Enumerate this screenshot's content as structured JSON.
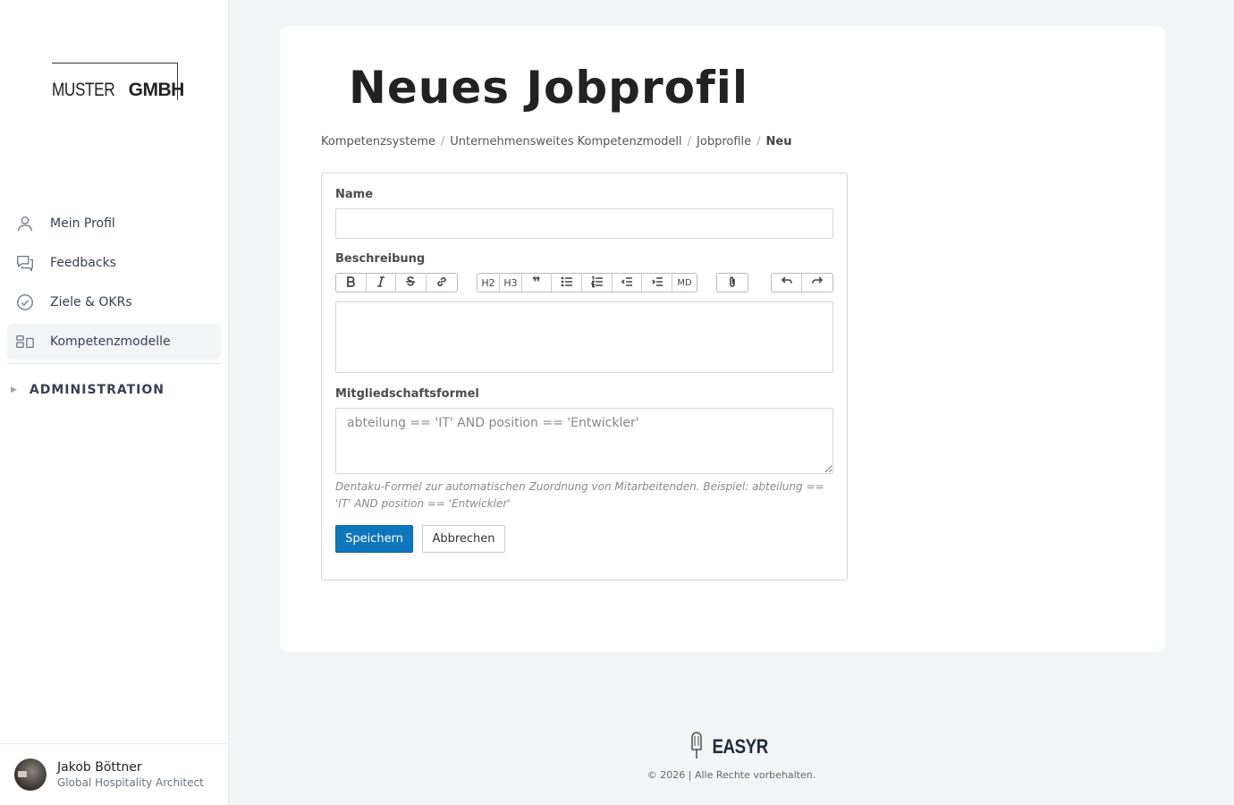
{
  "sidebar": {
    "logo": {
      "thin": "MUSTER",
      "bold": "GMBH"
    },
    "items": [
      {
        "label": "Mein Profil",
        "icon": "user-icon"
      },
      {
        "label": "Feedbacks",
        "icon": "chat-icon"
      },
      {
        "label": "Ziele & OKRs",
        "icon": "check-circle-icon"
      },
      {
        "label": "Kompetenzmodelle",
        "icon": "layout-icon",
        "active": true
      }
    ],
    "admin_label": "ADMINISTRATION",
    "user": {
      "name": "Jakob Böttner",
      "role": "Global Hospitality Architect"
    }
  },
  "main": {
    "title": "Neues Jobprofil",
    "breadcrumb": [
      "Kompetenzsysteme",
      "Unternehmensweites Kompetenzmodell",
      "Jobprofile",
      "Neu"
    ],
    "form": {
      "name_label": "Name",
      "name_value": "",
      "description_label": "Beschreibung",
      "toolbar": {
        "h2": "H2",
        "h3": "H3",
        "md": "MD"
      },
      "formula_label": "Mitgliedschaftsformel",
      "formula_placeholder": "abteilung == 'IT' AND position == 'Entwickler'",
      "formula_hint": "Dentaku-Formel zur automatischen Zuordnung von Mitarbeitenden. Beispiel: abteilung == 'IT' AND position == 'Entwickler'",
      "save_label": "Speichern",
      "cancel_label": "Abbrechen"
    }
  },
  "footer": {
    "brand": "EASYR",
    "copyright": "© 2026 | Alle Rechte vorbehalten."
  },
  "colors": {
    "primary": "#0e76bc",
    "background": "#f3f4f6"
  }
}
